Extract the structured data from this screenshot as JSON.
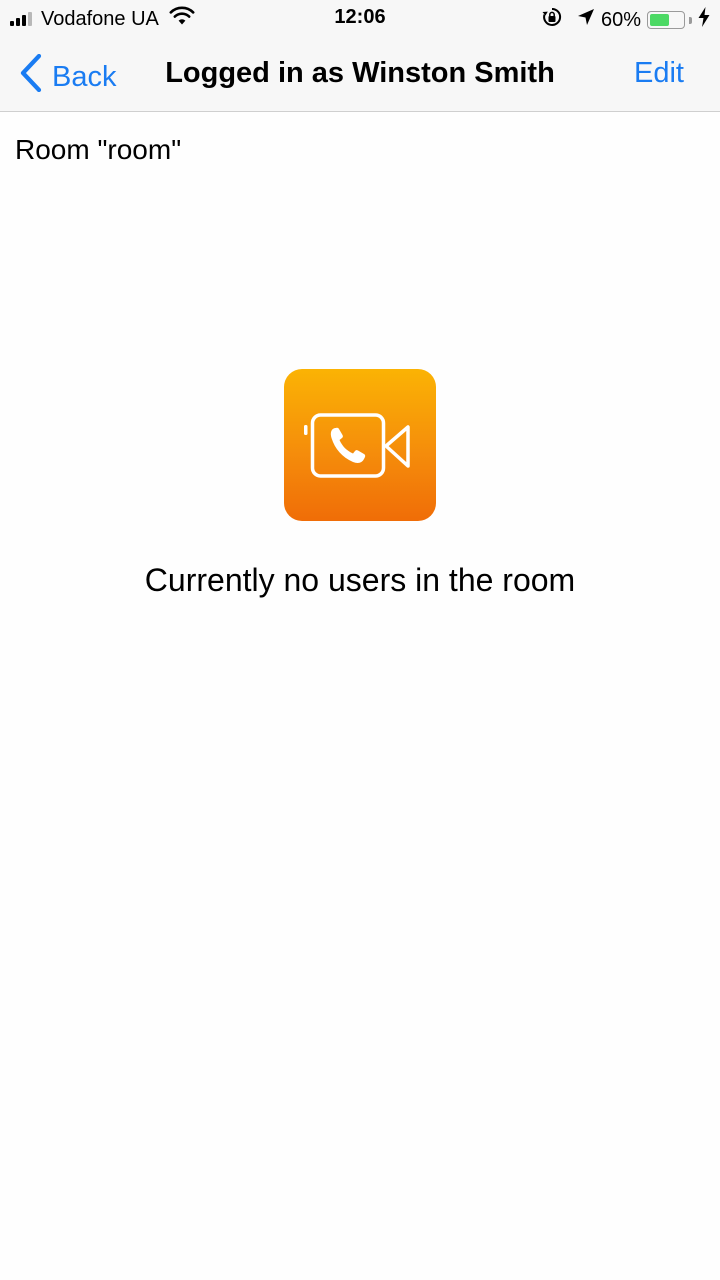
{
  "status_bar": {
    "carrier": "Vodafone UA",
    "time": "12:06",
    "battery_percent": "60%",
    "battery_level": 0.6,
    "icons": [
      "signal-icon",
      "wifi-icon",
      "rotation-lock-icon",
      "location-arrow-icon",
      "battery-icon",
      "charging-bolt-icon"
    ]
  },
  "nav": {
    "back_label": "Back",
    "title": "Logged in as Winston Smith",
    "edit_label": "Edit"
  },
  "room": {
    "label": "Room \"room\"",
    "icon": "video-call-icon",
    "empty_message": "Currently no users in the room"
  },
  "colors": {
    "accent": "#1a7cf2",
    "icon_gradient_top": "#fbb304",
    "icon_gradient_bottom": "#f06d07",
    "battery_fill": "#4cd964"
  }
}
